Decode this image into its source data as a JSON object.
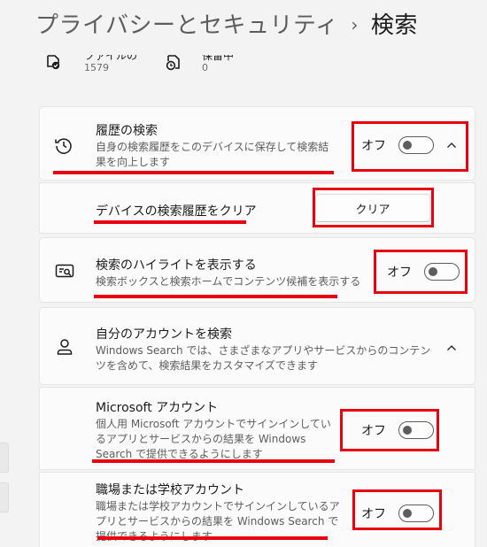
{
  "breadcrumb": {
    "parent": "プライバシーとセキュリティ",
    "separator": "›",
    "current": "検索"
  },
  "stats": [
    {
      "icon": "check-document-icon",
      "label": "ファイルの",
      "value": "1579"
    },
    {
      "icon": "clock-document-icon",
      "label": "保留中",
      "value": "0"
    }
  ],
  "search_history": {
    "title": "履歴の検索",
    "description": "自身の検索履歴をこのデバイスに保存して検索結果を向上します",
    "toggle_label": "オフ",
    "icon": "history-icon",
    "expanded": true
  },
  "clear_history": {
    "title": "デバイスの検索履歴をクリア",
    "button_label": "クリア"
  },
  "search_highlights": {
    "title": "検索のハイライトを表示する",
    "description": "検索ボックスと検索ホームでコンテンツ候補を表示する",
    "toggle_label": "オフ",
    "icon": "search-highlight-icon"
  },
  "cloud_search": {
    "title": "自分のアカウントを検索",
    "description": "Windows Search では、さまざまなアプリやサービスからのコンテンツを含めて、検索結果をカスタマイズできます",
    "icon": "person-icon",
    "expanded": true,
    "items": [
      {
        "title": "Microsoft アカウント",
        "description": "個人用 Microsoft アカウントでサインインしているアプリとサービスからの結果を Windows Search で提供できるようにします",
        "toggle_label": "オフ"
      },
      {
        "title": "職場または学校アカウント",
        "description": "職場または学校アカウントでサインインしているアプリとサービスからの結果を Windows Search で提供できるようにします",
        "toggle_label": "オフ"
      }
    ]
  },
  "colors": {
    "annotation": "#e60012",
    "background": "#f3f3f3",
    "card": "#fbfbfb"
  }
}
